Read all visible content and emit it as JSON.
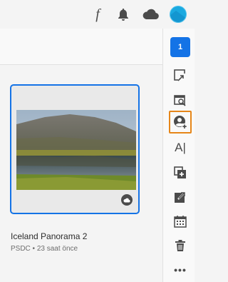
{
  "topbar": {
    "font_glyph": "f",
    "icons": [
      "font-icon",
      "bell-icon",
      "cloud-icon",
      "avatar"
    ]
  },
  "document": {
    "title": "Iceland Panorama 2",
    "meta": "PSDC • 23 saat önce",
    "sync_icon": "cloud-icon"
  },
  "rail": {
    "selected_count": "1",
    "text_tool_glyph": "A|",
    "more_glyph": "•••",
    "items": [
      "open-icon",
      "preview-icon",
      "invite-icon",
      "text-icon",
      "duplicate-icon",
      "share-icon",
      "calendar-icon",
      "trash-icon",
      "more-icon"
    ]
  },
  "colors": {
    "accent": "#1473e6",
    "focus": "#e68619",
    "icon": "#4b4b4b"
  }
}
